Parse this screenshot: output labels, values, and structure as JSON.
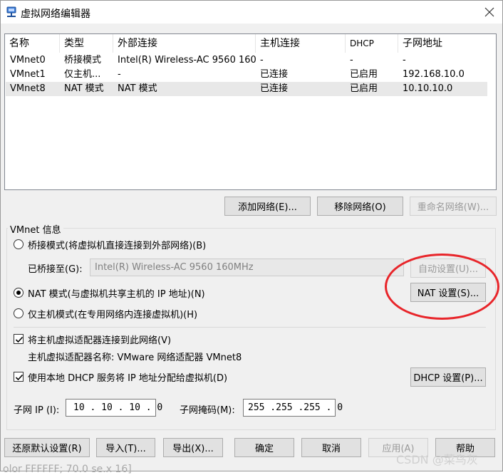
{
  "window": {
    "title": "虚拟网络编辑器"
  },
  "network_table": {
    "columns": [
      "名称",
      "类型",
      "外部连接",
      "主机连接",
      "DHCP",
      "子网地址"
    ],
    "rows": [
      {
        "name": "VMnet0",
        "type": "桥接模式",
        "external": "Intel(R) Wireless-AC 9560 160...",
        "host": "-",
        "dhcp": "-",
        "subnet": "-"
      },
      {
        "name": "VMnet1",
        "type": "仅主机...",
        "external": "-",
        "host": "已连接",
        "dhcp": "已启用",
        "subnet": "192.168.10.0"
      },
      {
        "name": "VMnet8",
        "type": "NAT 模式",
        "external": "NAT 模式",
        "host": "已连接",
        "dhcp": "已启用",
        "subnet": "10.10.10.0",
        "selected": true
      }
    ]
  },
  "list_buttons": {
    "add": "添加网络(E)...",
    "remove": "移除网络(O)",
    "rename": "重命名网络(W)..."
  },
  "vmnet_info": {
    "group_label": "VMnet 信息",
    "bridged_radio": "桥接模式(将虚拟机直接连接到外部网络)(B)",
    "bridged_to_label": "已桥接至(G):",
    "bridged_to_value": "Intel(R) Wireless-AC 9560 160MHz",
    "auto_settings": "自动设置(U)...",
    "nat_radio": "NAT 模式(与虚拟机共享主机的 IP 地址)(N)",
    "nat_settings": "NAT 设置(S)...",
    "hostonly_radio": "仅主机模式(在专用网络内连接虚拟机)(H)",
    "connect_adapter_check": "将主机虚拟适配器连接到此网络(V)",
    "adapter_name": "主机虚拟适配器名称: VMware 网络适配器 VMnet8",
    "dhcp_check": "使用本地 DHCP 服务将 IP 地址分配给虚拟机(D)",
    "dhcp_settings": "DHCP 设置(P)...",
    "subnet_ip_label": "子网 IP (I):",
    "subnet_ip_value": "10 . 10 . 10 . 0",
    "subnet_mask_label": "子网掩码(M):",
    "subnet_mask_value": "255 .255 .255 . 0"
  },
  "footer_buttons": {
    "restore": "还原默认设置(R)",
    "import": "导入(T)...",
    "export": "导出(X)...",
    "ok": "确定",
    "cancel": "取消",
    "apply": "应用(A)",
    "help": "帮助"
  },
  "watermark": "CSDN @菜鸟灰",
  "background_text": "olor FFFFFF; 70.0 se.x 16]",
  "colors": {
    "highlight_circle": "#e8252a",
    "selected_row": "#e8e8e8"
  }
}
